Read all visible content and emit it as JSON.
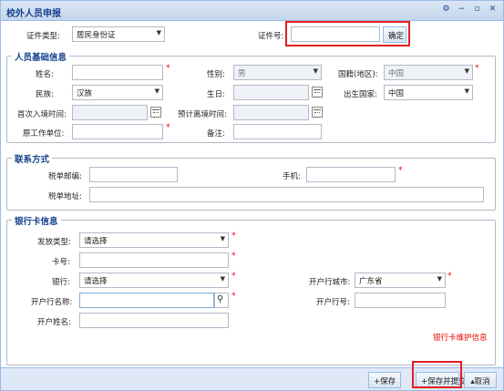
{
  "window": {
    "title": "校外人员申报",
    "tools": [
      "⚙",
      "−",
      "▫",
      "✕"
    ]
  },
  "top": {
    "id_type_label": "证件类型:",
    "id_type_value": "居民身份证",
    "id_no_label": "证件号:",
    "id_no_value": "",
    "confirm_button": "确定"
  },
  "basic": {
    "legend": "人员基础信息",
    "name_label": "姓名:",
    "name_value": "",
    "gender_label": "性别:",
    "gender_value": "男",
    "nationality_label": "国籍(地区):",
    "nationality_value": "中国",
    "ethnic_label": "民族:",
    "ethnic_value": "汉族",
    "birthday_label": "生日:",
    "birthday_value": "",
    "birth_country_label": "出生国家:",
    "birth_country_value": "中国",
    "entry_time_label": "首次入境时间:",
    "entry_time_value": "",
    "leave_time_label": "预计离境时间:",
    "leave_time_value": "",
    "employer_label": "原工作单位:",
    "employer_value": "",
    "remark_label": "备注:",
    "remark_value": ""
  },
  "contact": {
    "legend": "联系方式",
    "zip_label": "税单邮编:",
    "zip_value": "",
    "phone_label": "手机:",
    "phone_value": "",
    "addr_label": "税单地址:",
    "addr_value": ""
  },
  "bank": {
    "legend": "银行卡信息",
    "issue_type_label": "发放类型:",
    "issue_type_value": "请选择",
    "card_no_label": "卡号:",
    "card_no_value": "",
    "bank_label": "银行:",
    "bank_value": "请选择",
    "city_label": "开户行城市:",
    "city_value": "广东省",
    "branch_name_label": "开户行名称:",
    "branch_name_value": "",
    "branch_no_label": "开户行号:",
    "branch_no_value": "",
    "holder_label": "开户姓名:",
    "holder_value": "",
    "maintain_note": "银行卡维护信息"
  },
  "footer": {
    "save": "保存",
    "save_submit": "保存并提交",
    "cancel": "取消"
  },
  "required_mark": "*"
}
